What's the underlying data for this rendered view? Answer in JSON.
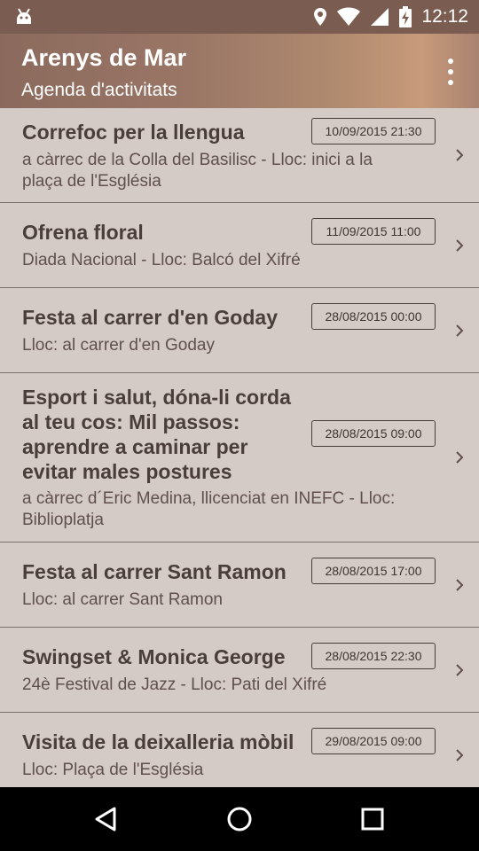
{
  "status_bar": {
    "time": "12:12",
    "icons": [
      "android-icon",
      "location-icon",
      "wifi-icon",
      "signal-icon",
      "battery-charging-icon"
    ]
  },
  "app_bar": {
    "title": "Arenys de Mar",
    "subtitle": "Agenda d'activitats",
    "menu_icon": "overflow-menu-icon"
  },
  "events": [
    {
      "title": "Correfoc per la llengua",
      "subtitle": "a càrrec de la Colla del Basilisc  - Lloc: inici a la plaça de l'Església",
      "date": "10/09/2015 21:30"
    },
    {
      "title": "Ofrena floral",
      "subtitle": "Diada Nacional  - Lloc: Balcó del Xifré",
      "date": "11/09/2015 11:00"
    },
    {
      "title": "Festa al carrer d'en Goday",
      "subtitle": "Lloc: al carrer d'en Goday",
      "date": "28/08/2015 00:00"
    },
    {
      "title": "Esport i salut, dóna-li corda al teu cos: Mil passos: aprendre a caminar per evitar males postures",
      "subtitle": "a càrrec d´Eric Medina, llicenciat en INEFC  - Lloc: Biblioplatja",
      "date": "28/08/2015 09:00"
    },
    {
      "title": "Festa al carrer Sant Ramon",
      "subtitle": "Lloc: al carrer Sant Ramon",
      "date": "28/08/2015 17:00"
    },
    {
      "title": "Swingset & Monica George",
      "subtitle": "24è Festival de Jazz  - Lloc: Pati del Xifré",
      "date": "28/08/2015 22:30"
    },
    {
      "title": "Visita de la deixalleria mòbil",
      "subtitle": "Lloc: Plaça de l'Església",
      "date": "29/08/2015 09:00"
    }
  ],
  "colors": {
    "status_bar": "#7a5c50",
    "app_bar": "#9a7666",
    "list_background": "#d4cbc7",
    "title_text": "#4a3e3a",
    "subtitle_text": "#5f504b",
    "divider": "#7d6f6b",
    "nav_bar": "#000000"
  },
  "nav_bar": {
    "icons": [
      "back-icon",
      "home-icon",
      "recents-icon"
    ]
  }
}
